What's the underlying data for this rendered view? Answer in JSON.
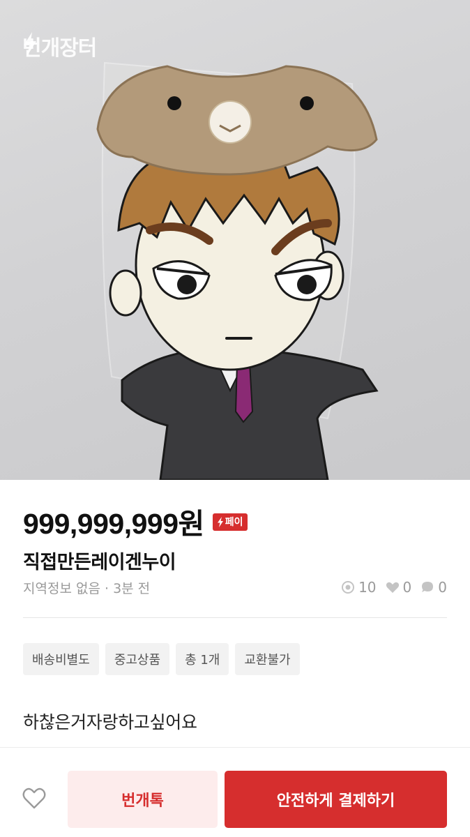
{
  "photo": {
    "watermark_text": "번개장터",
    "alt": "photo"
  },
  "product": {
    "price": "999,999,999원",
    "pay_badge_label": "페이",
    "title": "직접만든레이겐누이",
    "location": "지역정보 없음",
    "time_ago": "3분 전",
    "separator": "·",
    "stats": {
      "views": "10",
      "likes": "0",
      "chats": "0"
    },
    "tags": [
      "배송비별도",
      "중고상품",
      "총 1개",
      "교환불가"
    ],
    "description": "하찮은거자랑하고싶어요"
  },
  "actions": {
    "chat_label": "번개톡",
    "pay_label": "안전하게 결제하기"
  },
  "icons": {
    "watermark": "bolt-icon",
    "views": "eye-icon",
    "likes": "heart-icon",
    "chats": "chat-bubble-icon",
    "like_button": "heart-outline-icon"
  },
  "colors": {
    "accent": "#d62e2e",
    "accent_light": "#fdecec",
    "muted": "#9a9a9a"
  }
}
